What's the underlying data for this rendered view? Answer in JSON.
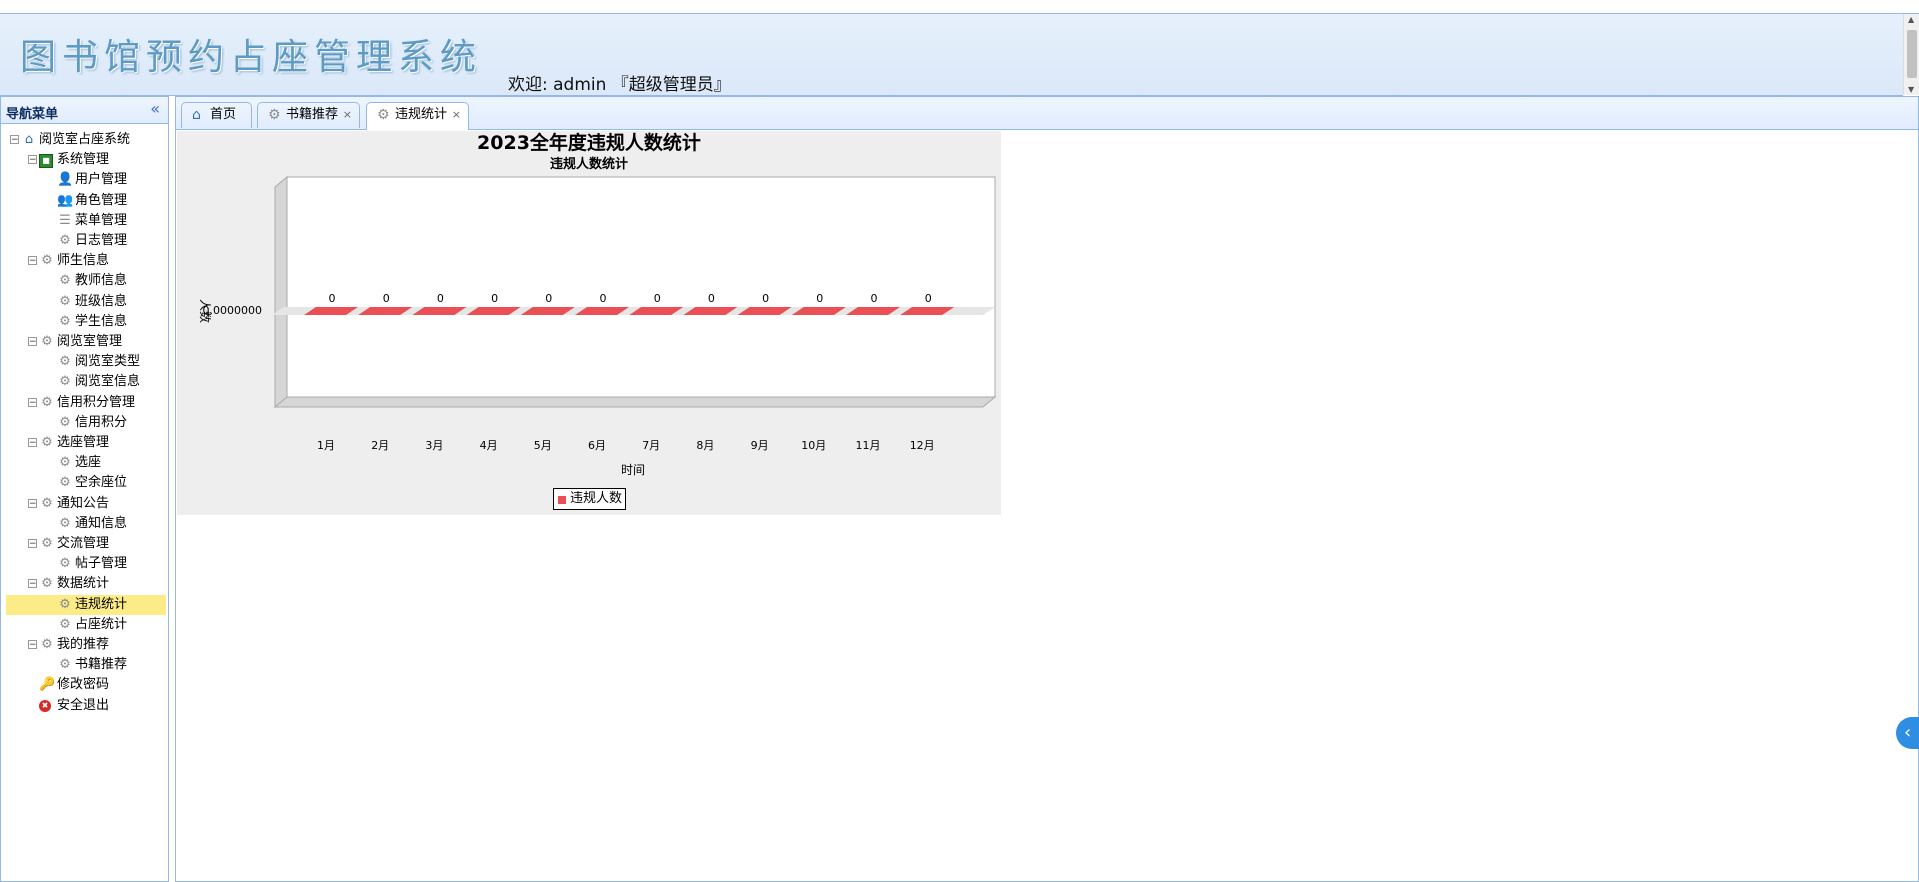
{
  "header": {
    "title": "图书馆预约占座管理系统",
    "welcome": "欢迎: admin 『超级管理员』"
  },
  "sidebar": {
    "title": "导航菜单",
    "collapse_icon": "double-chevron-left-icon",
    "nodes": [
      {
        "label": "阅览室占座系统",
        "icon": "home-icon"
      },
      {
        "label": "系统管理",
        "icon": "green-square-icon"
      },
      {
        "label": "用户管理",
        "icon": "user-icon"
      },
      {
        "label": "角色管理",
        "icon": "users-icon"
      },
      {
        "label": "菜单管理",
        "icon": "menu-icon"
      },
      {
        "label": "日志管理",
        "icon": "gear-icon"
      },
      {
        "label": "师生信息",
        "icon": "gear-icon"
      },
      {
        "label": "教师信息",
        "icon": "gear-icon"
      },
      {
        "label": "班级信息",
        "icon": "gear-icon"
      },
      {
        "label": "学生信息",
        "icon": "gear-icon"
      },
      {
        "label": "阅览室管理",
        "icon": "gear-icon"
      },
      {
        "label": "阅览室类型",
        "icon": "gear-icon"
      },
      {
        "label": "阅览室信息",
        "icon": "gear-icon"
      },
      {
        "label": "信用积分管理",
        "icon": "gear-icon"
      },
      {
        "label": "信用积分",
        "icon": "gear-icon"
      },
      {
        "label": "选座管理",
        "icon": "gear-icon"
      },
      {
        "label": "选座",
        "icon": "gear-icon"
      },
      {
        "label": "空余座位",
        "icon": "gear-icon"
      },
      {
        "label": "通知公告",
        "icon": "gear-icon"
      },
      {
        "label": "通知信息",
        "icon": "gear-icon"
      },
      {
        "label": "交流管理",
        "icon": "gear-icon"
      },
      {
        "label": "帖子管理",
        "icon": "gear-icon"
      },
      {
        "label": "数据统计",
        "icon": "gear-icon"
      },
      {
        "label": "违规统计",
        "icon": "gear-icon"
      },
      {
        "label": "占座统计",
        "icon": "gear-icon"
      },
      {
        "label": "我的推荐",
        "icon": "gear-icon"
      },
      {
        "label": "书籍推荐",
        "icon": "gear-icon"
      },
      {
        "label": "修改密码",
        "icon": "key-icon"
      },
      {
        "label": "安全退出",
        "icon": "exit-icon"
      }
    ]
  },
  "tabs": [
    {
      "label": "首页",
      "icon": "home-icon",
      "closable": false
    },
    {
      "label": "书籍推荐",
      "icon": "gear-icon",
      "closable": true
    },
    {
      "label": "违规统计",
      "icon": "gear-icon",
      "closable": true,
      "active": true
    }
  ],
  "tab_close": "×",
  "chart_data": {
    "type": "bar",
    "title": "2023全年度违规人数统计",
    "subtitle": "违规人数统计",
    "xlabel": "时间",
    "ylabel": "人数",
    "y_tick_label": "0.0000000",
    "categories": [
      "1月",
      "2月",
      "3月",
      "4月",
      "5月",
      "6月",
      "7月",
      "8月",
      "9月",
      "10月",
      "11月",
      "12月"
    ],
    "series": [
      {
        "name": "违规人数",
        "values": [
          0,
          0,
          0,
          0,
          0,
          0,
          0,
          0,
          0,
          0,
          0,
          0
        ],
        "color": "#e94f55"
      }
    ],
    "grid": false,
    "legend": "bottom-center"
  },
  "side_toggle": "‹",
  "colors": {
    "border": "#95b8e7",
    "selected": "#fbec88",
    "bar": "#e94f55"
  }
}
